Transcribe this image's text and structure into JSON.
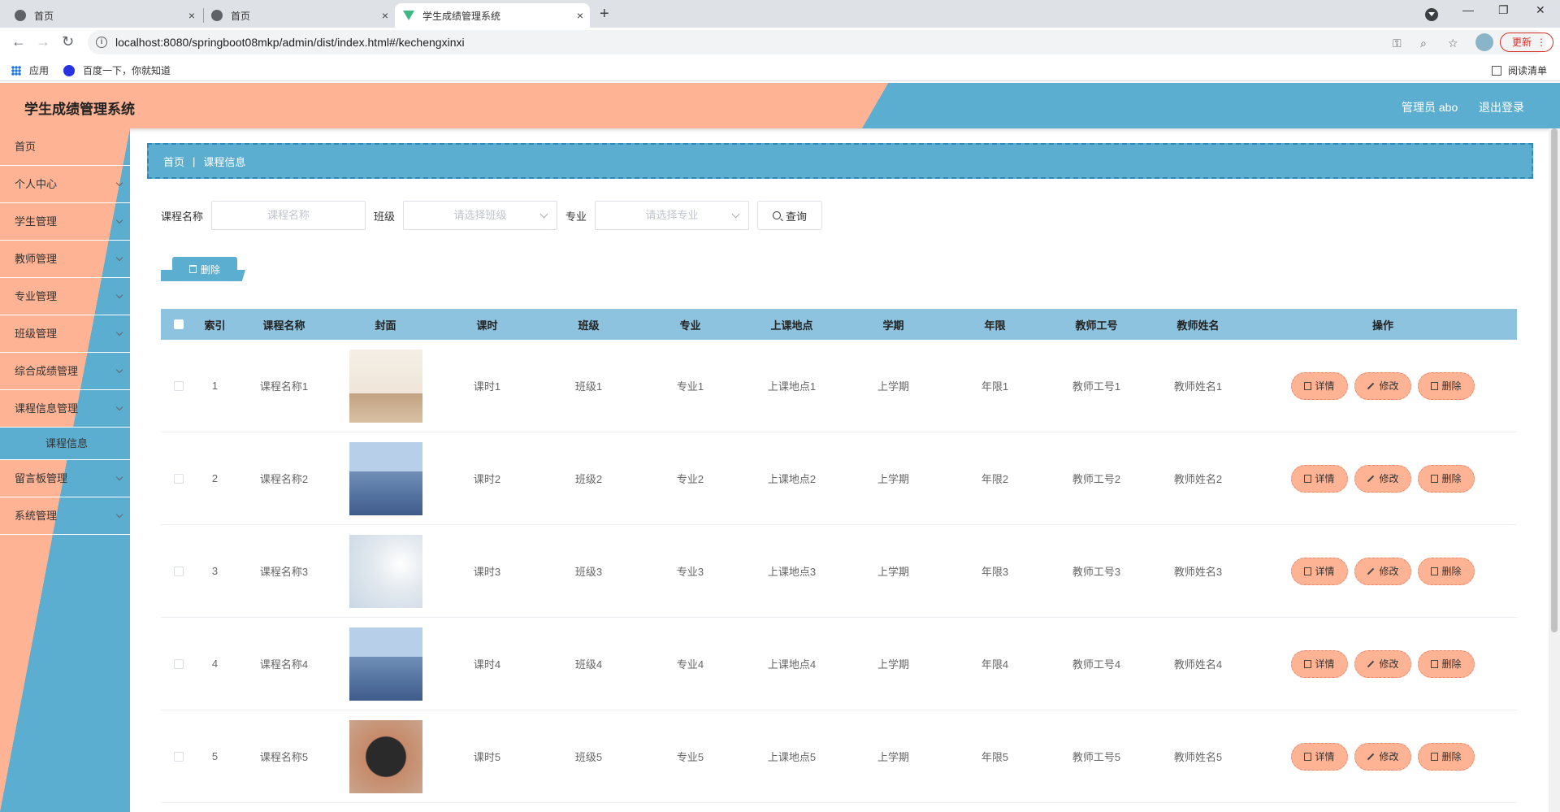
{
  "browser": {
    "tabs": [
      {
        "title": "首页",
        "close": "×"
      },
      {
        "title": "首页",
        "close": "×"
      },
      {
        "title": "学生成绩管理系统",
        "close": "×"
      }
    ],
    "new_tab": "+",
    "window_controls": {
      "minimize": "—",
      "maximize": "❐",
      "close": "✕"
    },
    "back": "←",
    "forward": "→",
    "reload": "↻",
    "url": "localhost:8080/springboot08mkp/admin/dist/index.html#/kechengxinxi",
    "info_icon": "i",
    "update_label": "更新",
    "menu_dots": "⋮",
    "omni_icons": {
      "key": "⚿",
      "zoom": "⌕",
      "star": "☆"
    },
    "bookmarks": [
      {
        "label": "应用"
      },
      {
        "label": "百度一下，你就知道"
      }
    ],
    "reading_list": "阅读清单"
  },
  "app": {
    "title": "学生成绩管理系统",
    "user": "管理员 abo",
    "logout": "退出登录",
    "colors": {
      "primary": "#5caed1",
      "accent": "#fdb394",
      "header_row": "#8dc3de"
    }
  },
  "sidebar": {
    "items": [
      {
        "label": "首页"
      },
      {
        "label": "个人中心"
      },
      {
        "label": "学生管理"
      },
      {
        "label": "教师管理"
      },
      {
        "label": "专业管理"
      },
      {
        "label": "班级管理"
      },
      {
        "label": "综合成绩管理"
      },
      {
        "label": "课程信息管理"
      },
      {
        "label": "课程信息"
      },
      {
        "label": "留言板管理"
      },
      {
        "label": "系统管理"
      }
    ]
  },
  "breadcrumb": {
    "home": "首页",
    "separator": "|",
    "current": "课程信息"
  },
  "search": {
    "name_label": "课程名称",
    "name_placeholder": "课程名称",
    "class_label": "班级",
    "class_placeholder": "请选择班级",
    "major_label": "专业",
    "major_placeholder": "请选择专业",
    "query_button": "查询"
  },
  "actions": {
    "delete_button": "删除"
  },
  "table": {
    "headers": [
      "索引",
      "课程名称",
      "封面",
      "课时",
      "班级",
      "专业",
      "上课地点",
      "学期",
      "年限",
      "教师工号",
      "教师姓名",
      "操作"
    ],
    "buttons": {
      "detail": "详情",
      "edit": "修改",
      "delete": "删除"
    },
    "rows": [
      {
        "idx": "1",
        "name": "课程名称1",
        "hours": "课时1",
        "class": "班级1",
        "major": "专业1",
        "place": "上课地点1",
        "term": "上学期",
        "years": "年限1",
        "teacher_no": "教师工号1",
        "teacher_name": "教师姓名1"
      },
      {
        "idx": "2",
        "name": "课程名称2",
        "hours": "课时2",
        "class": "班级2",
        "major": "专业2",
        "place": "上课地点2",
        "term": "上学期",
        "years": "年限2",
        "teacher_no": "教师工号2",
        "teacher_name": "教师姓名2"
      },
      {
        "idx": "3",
        "name": "课程名称3",
        "hours": "课时3",
        "class": "班级3",
        "major": "专业3",
        "place": "上课地点3",
        "term": "上学期",
        "years": "年限3",
        "teacher_no": "教师工号3",
        "teacher_name": "教师姓名3"
      },
      {
        "idx": "4",
        "name": "课程名称4",
        "hours": "课时4",
        "class": "班级4",
        "major": "专业4",
        "place": "上课地点4",
        "term": "上学期",
        "years": "年限4",
        "teacher_no": "教师工号4",
        "teacher_name": "教师姓名4"
      },
      {
        "idx": "5",
        "name": "课程名称5",
        "hours": "课时5",
        "class": "班级5",
        "major": "专业5",
        "place": "上课地点5",
        "term": "上学期",
        "years": "年限5",
        "teacher_no": "教师工号5",
        "teacher_name": "教师姓名5"
      }
    ]
  }
}
